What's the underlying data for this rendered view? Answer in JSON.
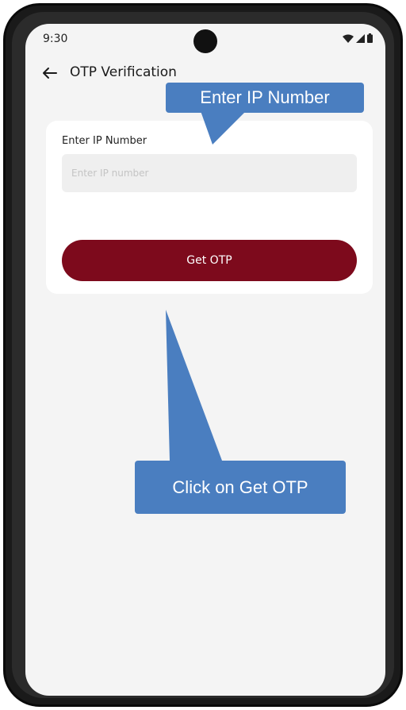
{
  "status_bar": {
    "time": "9:30",
    "icons": [
      "wifi-icon",
      "signal-icon",
      "battery-icon"
    ]
  },
  "header": {
    "back_icon": "arrow-left-icon",
    "title": "OTP Verification"
  },
  "form": {
    "field_label": "Enter IP Number",
    "field_value": "",
    "field_placeholder": "Enter IP number",
    "button_label": "Get OTP"
  },
  "annotations": {
    "callout_top": "Enter IP Number",
    "callout_bottom": "Click on Get OTP"
  },
  "colors": {
    "accent": "#7d0a1c",
    "screen_bg": "#f4f4f4",
    "callout": "#4a7ec0"
  }
}
